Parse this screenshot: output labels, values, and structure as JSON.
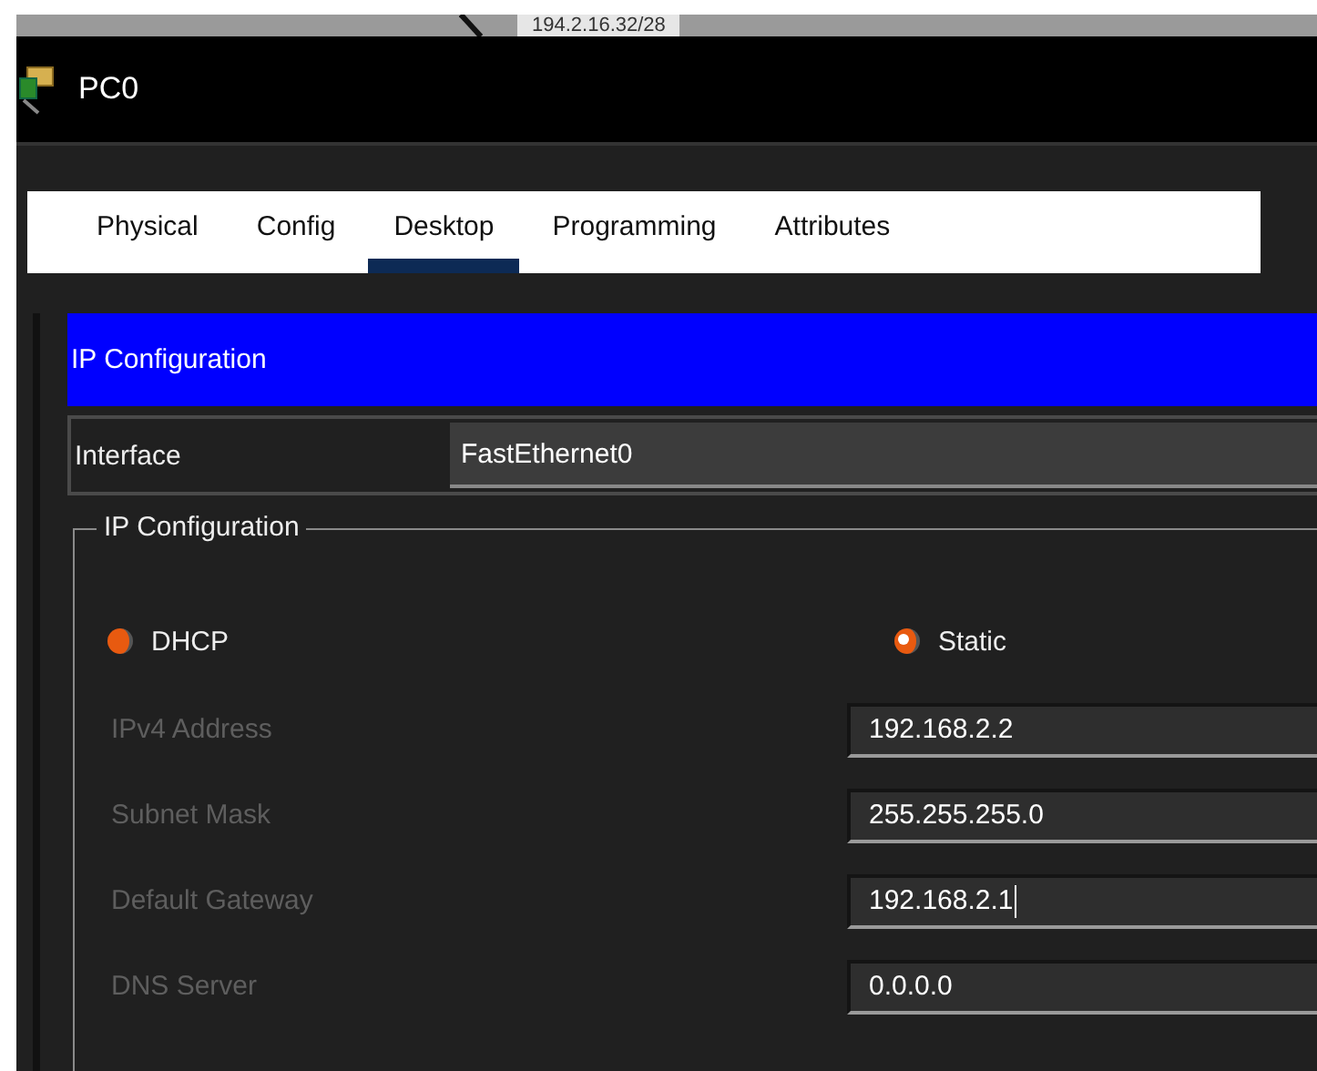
{
  "canvas_label": "194.2.16.32/28",
  "window": {
    "title": "PC0"
  },
  "tabs": [
    {
      "label": "Physical",
      "selected": false
    },
    {
      "label": "Config",
      "selected": false
    },
    {
      "label": "Desktop",
      "selected": true
    },
    {
      "label": "Programming",
      "selected": false
    },
    {
      "label": "Attributes",
      "selected": false
    }
  ],
  "section_header": "IP Configuration",
  "interface": {
    "label": "Interface",
    "value": "FastEthernet0"
  },
  "ip_group": {
    "legend": "IP Configuration",
    "modes": [
      {
        "label": "DHCP",
        "selected": false
      },
      {
        "label": "Static",
        "selected": true
      }
    ],
    "fields": [
      {
        "label": "IPv4 Address",
        "value": "192.168.2.2",
        "disabled": true,
        "focused": false
      },
      {
        "label": "Subnet Mask",
        "value": "255.255.255.0",
        "disabled": true,
        "focused": false
      },
      {
        "label": "Default Gateway",
        "value": "192.168.2.1",
        "disabled": true,
        "focused": true
      },
      {
        "label": "DNS Server",
        "value": "0.0.0.0",
        "disabled": true,
        "focused": false
      }
    ]
  }
}
